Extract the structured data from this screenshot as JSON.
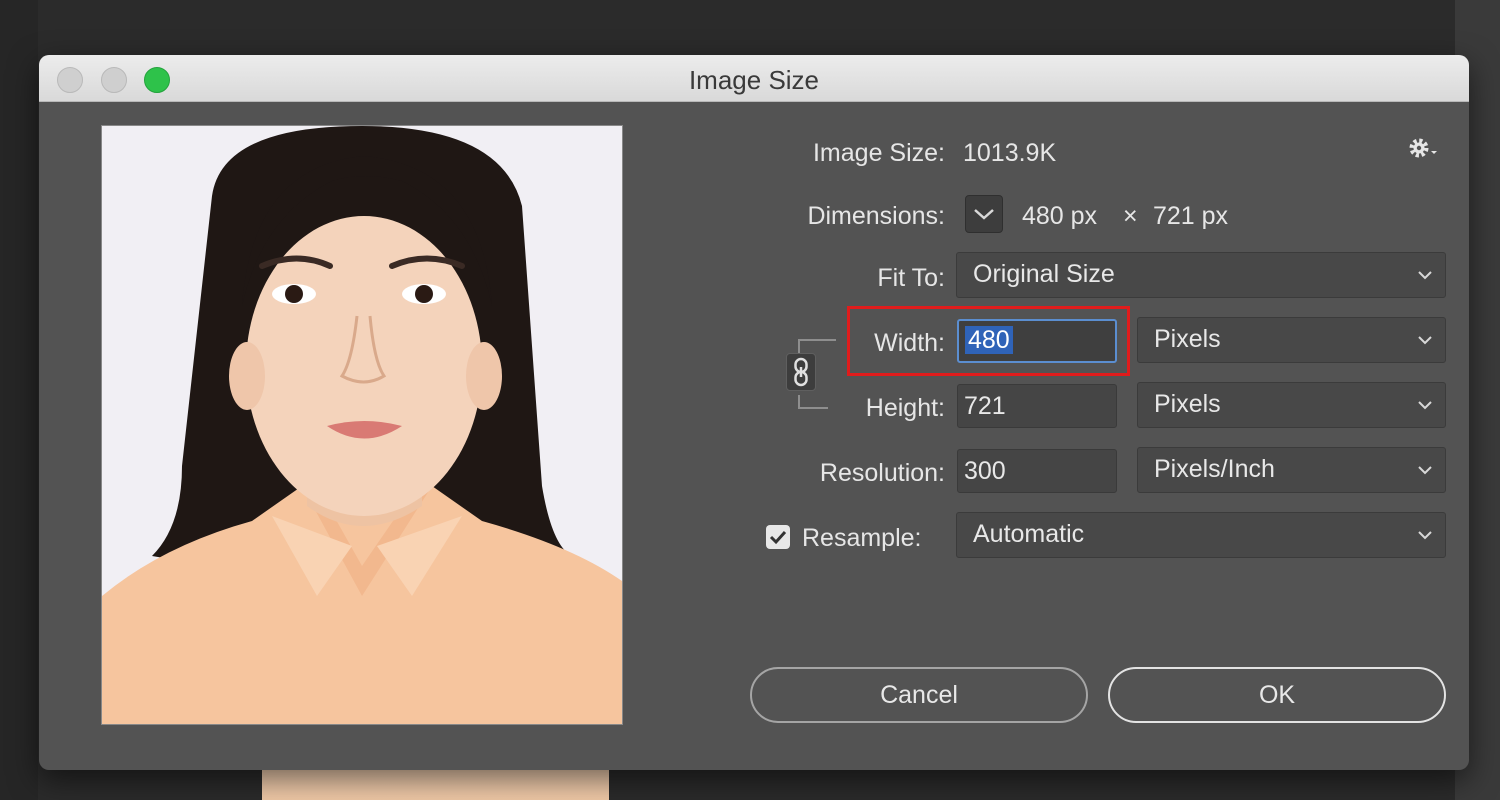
{
  "dialog": {
    "title": "Image Size",
    "window_controls": [
      "close",
      "minimize",
      "zoom"
    ]
  },
  "info": {
    "image_size_label": "Image Size:",
    "image_size_value": "1013.9K",
    "dimensions_label": "Dimensions:",
    "dim_width": "480 px",
    "dim_times": "×",
    "dim_height": "721 px",
    "settings_icon": "gear-icon"
  },
  "fit_to": {
    "label": "Fit To:",
    "value": "Original Size"
  },
  "width": {
    "label": "Width:",
    "value": "480",
    "unit": "Pixels"
  },
  "height": {
    "label": "Height:",
    "value": "721",
    "unit": "Pixels"
  },
  "resolution": {
    "label": "Resolution:",
    "value": "300",
    "unit": "Pixels/Inch"
  },
  "resample": {
    "label": "Resample:",
    "checked": true,
    "value": "Automatic"
  },
  "buttons": {
    "cancel": "Cancel",
    "ok": "OK"
  },
  "colors": {
    "dialog_bg": "#535353",
    "field_bg": "#454545",
    "selection": "#2f63b8",
    "highlight_box": "#e01c1c",
    "zoom_button": "#2ec24a"
  }
}
